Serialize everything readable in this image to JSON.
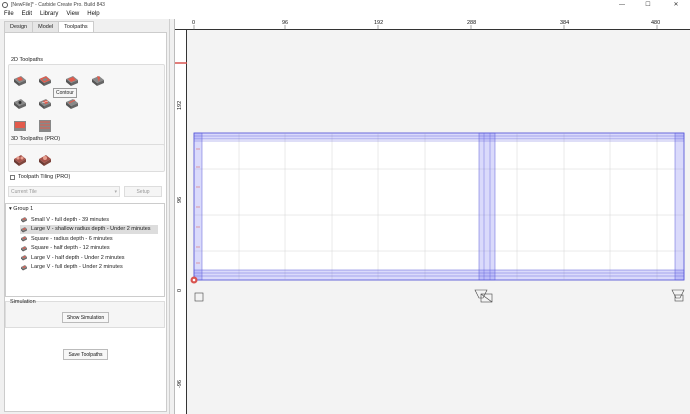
{
  "window": {
    "title": "[NewFile]* - Carbide Create Pro. Build 843",
    "controls": {
      "minimize": "—",
      "maximize": "☐",
      "close": "✕"
    }
  },
  "menu": [
    "File",
    "Edit",
    "Library",
    "View",
    "Help"
  ],
  "left_panel": {
    "tabs": [
      "Design",
      "Model",
      "Toolpaths"
    ],
    "active_tab": "Toolpaths",
    "toolpaths_2d": {
      "title": "2D Toolpaths",
      "tooltip": "Contour"
    },
    "toolpaths_3d": {
      "title": "3D Toolpaths (PRO)"
    },
    "tiling": {
      "checkbox_label": "Toolpath Tiling (PRO)",
      "checked": false,
      "dropdown_value": "Current Tile",
      "setup_label": "Setup"
    },
    "toolpath_list": {
      "group_label": "Group 1",
      "items": [
        "Small V - full depth - 39 minutes",
        "Large V - shallow radius depth - Under 2 minutes",
        "Square - radius depth - 6 minutes",
        "Square - half depth - 12 minutes",
        "Large V - half depth - Under 2 minutes",
        "Large V - full depth - Under 2 minutes"
      ],
      "selected_index": 1
    },
    "simulation": {
      "title": "Simulation",
      "show_label": "Show Simulation"
    },
    "save_label": "Save Toolpaths"
  },
  "canvas": {
    "ruler_top": [
      "0",
      "96",
      "192",
      "288",
      "384",
      "480"
    ],
    "ruler_left": [
      "192",
      "96",
      "0",
      "-96"
    ]
  },
  "colors": {
    "accent_red": "#d9534f",
    "selection_blue": "#5a5ad8",
    "stock_fill": "#ffffff"
  }
}
